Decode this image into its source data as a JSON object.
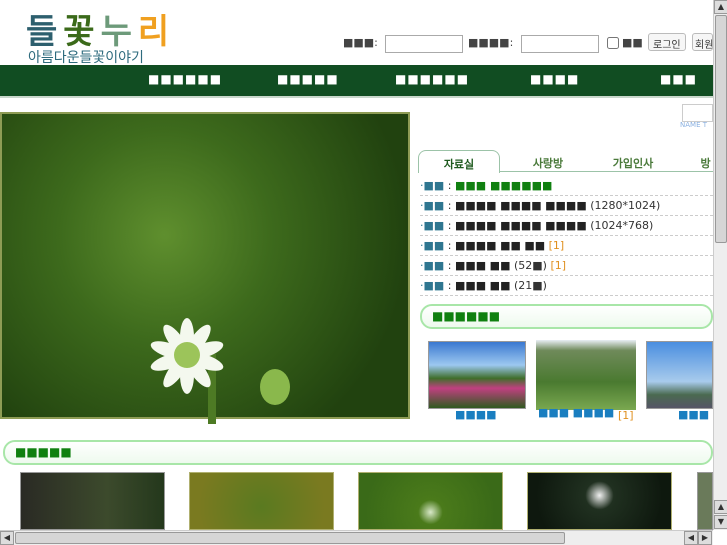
{
  "logo": {
    "title_chars": [
      "들",
      "꽃",
      "누",
      "리"
    ],
    "subtitle": "아름다운들꽃이야기"
  },
  "login": {
    "id_label": "■■■:",
    "pw_label": "■■■■:",
    "id_value": "",
    "pw_value": "",
    "remember_label": "■■",
    "login_button": "로그인",
    "join_button": "회원"
  },
  "nav": [
    "■■■■■■",
    "■■■■■",
    "■■■■■■",
    "■■■■",
    "■■■"
  ],
  "side_name": "NAME T",
  "tabs": [
    "자료실",
    "사랑방",
    "가입인사",
    "방"
  ],
  "list": [
    {
      "k": "■■",
      "t": "■■■ ■■■■■■",
      "green": true,
      "extra": "",
      "count": ""
    },
    {
      "k": "■■",
      "t": "■■■■ ■■■■ ■■■■",
      "extra": "(1280*1024)",
      "count": ""
    },
    {
      "k": "■■",
      "t": "■■■■ ■■■■ ■■■■",
      "extra": "(1024*768)",
      "count": ""
    },
    {
      "k": "■■",
      "t": "■■■■ ■■ ■■",
      "extra": "",
      "count": "[1]"
    },
    {
      "k": "■■",
      "t": "■■■ ■■",
      "extra": "(52■)",
      "count": "[1]"
    },
    {
      "k": "■■",
      "t": "■■■ ■■",
      "extra": "(21■)",
      "count": ""
    }
  ],
  "gallery_header": "■■■■■■",
  "gallery": [
    {
      "caption": "■■■■",
      "count": ""
    },
    {
      "caption": "■■■ ■■■■",
      "count": "[1]"
    },
    {
      "caption": "■■■",
      "count": ""
    }
  ],
  "section_header": "■■■■■",
  "colors": {
    "nav": "#114d22",
    "accent": "#108010",
    "link": "#2e7690",
    "count": "#e09020"
  }
}
